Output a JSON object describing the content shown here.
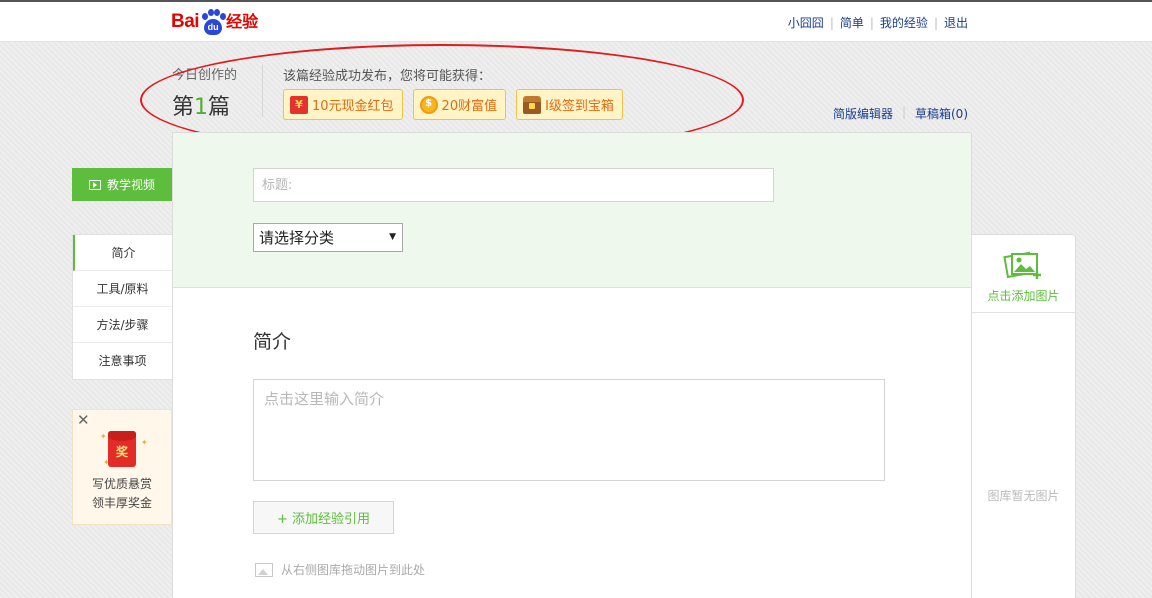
{
  "header": {
    "logo": {
      "bai": "Bai",
      "du": "du",
      "jingyan": "经验"
    },
    "links": [
      "小囧囧",
      "简单",
      "我的经验",
      "退出"
    ]
  },
  "today": {
    "label": "今日创作的",
    "prefix": "第",
    "number": "1",
    "suffix": "篇"
  },
  "rewards": {
    "title": "该篇经验成功发布，您将可能获得：",
    "items": [
      {
        "label": "10元现金红包",
        "icon": "red-envelope-icon"
      },
      {
        "label": "20财富值",
        "icon": "coin-icon"
      },
      {
        "label": "I级签到宝箱",
        "icon": "treasure-chest-icon"
      }
    ]
  },
  "toolbar": {
    "simple_editor": "简版编辑器",
    "drafts": "草稿箱(0)"
  },
  "sidebar": {
    "video_btn": "教学视频",
    "items": [
      {
        "label": "简介",
        "active": true
      },
      {
        "label": "工具/原料"
      },
      {
        "label": "方法/步骤"
      },
      {
        "label": "注意事项"
      }
    ]
  },
  "promo": {
    "close": "✕",
    "envelope_text": "奖",
    "line1": "写优质悬赏",
    "line2": "领丰厚奖金"
  },
  "editor": {
    "title_placeholder": "标题:",
    "category_select": "请选择分类",
    "section_title": "简介",
    "intro_placeholder": "点击这里输入简介",
    "add_reference": "+ 添加经验引用",
    "drag_hint": "从右侧图库拖动图片到此处"
  },
  "gallery": {
    "add_label": "点击添加图片",
    "empty_label": "图库暂无图片"
  },
  "colors": {
    "brand_green": "#5dbd3c",
    "baidu_red": "#e10601",
    "baidu_blue": "#2b47d8",
    "link_blue": "#1a3e8c",
    "annotation_red": "#e21b1b"
  }
}
